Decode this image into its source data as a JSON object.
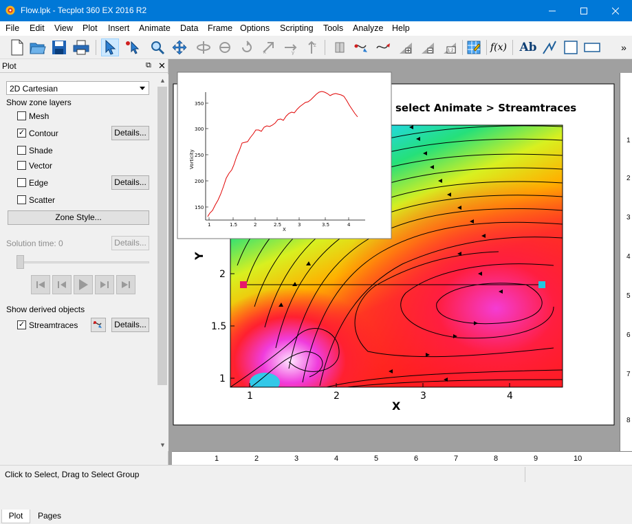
{
  "window": {
    "title": "Flow.lpk - Tecplot 360 EX 2016 R2"
  },
  "menu": [
    "File",
    "Edit",
    "View",
    "Plot",
    "Insert",
    "Animate",
    "Data",
    "Frame",
    "Options",
    "Scripting",
    "Tools",
    "Analyze",
    "Help"
  ],
  "toolbar": {
    "overflow_label": "»",
    "text_tool_label": "Ab",
    "function_label": "f(x)"
  },
  "panel": {
    "title": "Plot",
    "plot_type": "2D Cartesian",
    "zone_layers_heading": "Show zone layers",
    "layers": [
      {
        "label": "Mesh",
        "checked": false,
        "details": ""
      },
      {
        "label": "Contour",
        "checked": true,
        "details": "Details..."
      },
      {
        "label": "Shade",
        "checked": false,
        "details": ""
      },
      {
        "label": "Vector",
        "checked": false,
        "details": ""
      },
      {
        "label": "Edge",
        "checked": false,
        "details": "Details..."
      },
      {
        "label": "Scatter",
        "checked": false,
        "details": ""
      }
    ],
    "zone_style_button": "Zone Style...",
    "solution_time_label": "Solution time:",
    "solution_time_value": "0",
    "solution_details_button": "Details...",
    "derived_heading": "Show derived objects",
    "streamtraces_label": "Streamtraces",
    "streamtraces_checked": true,
    "streamtraces_details": "Details..."
  },
  "tabs": [
    "Plot",
    "Pages"
  ],
  "plot": {
    "hint_text": "select Animate > Streamtraces",
    "x_axis_title": "X",
    "y_axis_title": "Y",
    "x_ticks": [
      "1",
      "2",
      "3",
      "4"
    ],
    "y_ticks": [
      "1",
      "1.5",
      "2"
    ]
  },
  "inset_plot": {
    "x_label": "X",
    "y_label": "Vorticity",
    "x_ticks": [
      "1",
      "1.5",
      "2",
      "2.5",
      "3",
      "3.5",
      "4"
    ],
    "y_ticks": [
      "150",
      "200",
      "250",
      "300",
      "350"
    ],
    "line_color": "#e00000"
  },
  "rulers": {
    "vertical": [
      "1",
      "2",
      "3",
      "4",
      "5",
      "6",
      "7",
      "8"
    ],
    "horizontal": [
      "1",
      "2",
      "3",
      "4",
      "5",
      "6",
      "7",
      "8",
      "9",
      "10"
    ]
  },
  "status": {
    "message": "Click to Select, Drag to Select Group"
  },
  "colors": {
    "titlebar": "#0078d7",
    "selection_start": "#e8176a",
    "selection_end": "#21c9e0"
  }
}
